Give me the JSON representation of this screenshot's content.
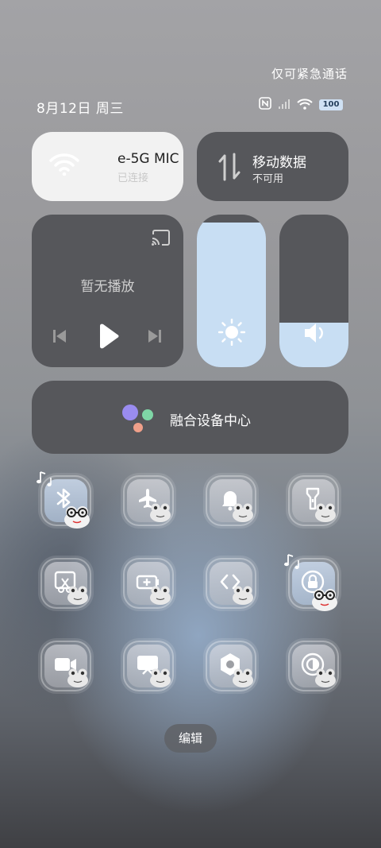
{
  "status_bar": {
    "emergency_text": "仅可紧急通话",
    "date": "8月12日 周三",
    "battery": "100",
    "icons": [
      "nfc-icon",
      "signal-icon",
      "wifi-icon",
      "battery-icon"
    ]
  },
  "wifi_tile": {
    "name": "e-5G     MIC",
    "status": "已连接"
  },
  "data_tile": {
    "title": "移动数据",
    "status": "不可用"
  },
  "media_tile": {
    "text": "暂无播放"
  },
  "brightness": {
    "level": 0.95
  },
  "volume": {
    "level": 0.29
  },
  "fusion": {
    "label": "融合设备中心"
  },
  "toggles": [
    "bluetooth",
    "airplane-mode",
    "silent",
    "flashlight",
    "screenshot",
    "battery-saver",
    "vpn-link",
    "lock-screen",
    "screen-record",
    "cast-screen",
    "settings",
    "reading-mode"
  ],
  "edit_label": "编辑",
  "colors": {
    "accent": "#c8def3",
    "tile": "#56575b",
    "wifi_tile": "#f2f2f2"
  }
}
